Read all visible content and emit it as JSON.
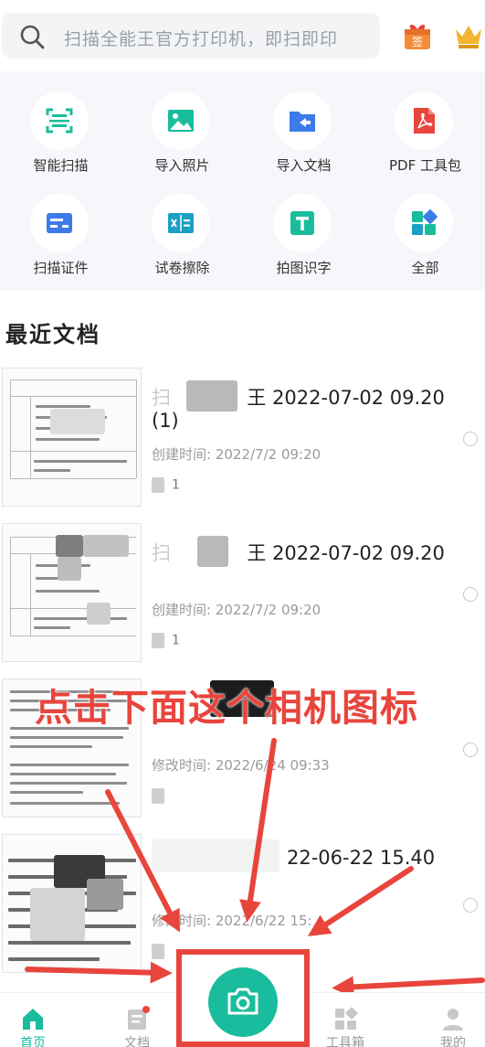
{
  "search": {
    "placeholder": "扫描全能王官方打印机，即扫即印"
  },
  "header": {
    "gift_icon_text": "签"
  },
  "tools": [
    {
      "label": "智能扫描",
      "icon": "scan-frame-icon",
      "color": "#19bc9c"
    },
    {
      "label": "导入照片",
      "icon": "image-icon",
      "color": "#19bc9c"
    },
    {
      "label": "导入文档",
      "icon": "folder-import-icon",
      "color": "#3d7be8"
    },
    {
      "label": "PDF 工具包",
      "icon": "pdf-icon",
      "color": "#e8453c"
    },
    {
      "label": "扫描证件",
      "icon": "id-card-icon",
      "color": "#3d7be8"
    },
    {
      "label": "试卷擦除",
      "icon": "eraser-icon",
      "color": "#1aa0c4"
    },
    {
      "label": "拍图识字",
      "icon": "text-recognize-icon",
      "color": "#19bc9c"
    },
    {
      "label": "全部",
      "icon": "grid-all-icon",
      "color": "#19bc9c"
    }
  ],
  "recent": {
    "title": "最近文档",
    "docs": [
      {
        "title_prefix": "扫",
        "title_mid": "王",
        "title": "2022-07-02 09.20",
        "title_line2": "(1)",
        "meta": "创建时间: 2022/7/2 09:20",
        "pages": "1"
      },
      {
        "title_prefix": "扫",
        "title_mid": "王",
        "title": "2022-07-02 09.20",
        "meta": "创建时间: 2022/7/2 09:20",
        "pages": "1"
      },
      {
        "title": "",
        "meta": "修改时间: 2022/6/24 09:33",
        "pages": ""
      },
      {
        "title": "22-06-22 15.40",
        "meta": "修改时间: 2022/6/22 15:",
        "pages": ""
      }
    ]
  },
  "annotation": {
    "text": "点击下面这个相机图标"
  },
  "nav": {
    "home": "首页",
    "docs": "文档",
    "tools": "工具箱",
    "me": "我的"
  },
  "colors": {
    "accent": "#19bc9c",
    "annotation": "#e8453c"
  }
}
